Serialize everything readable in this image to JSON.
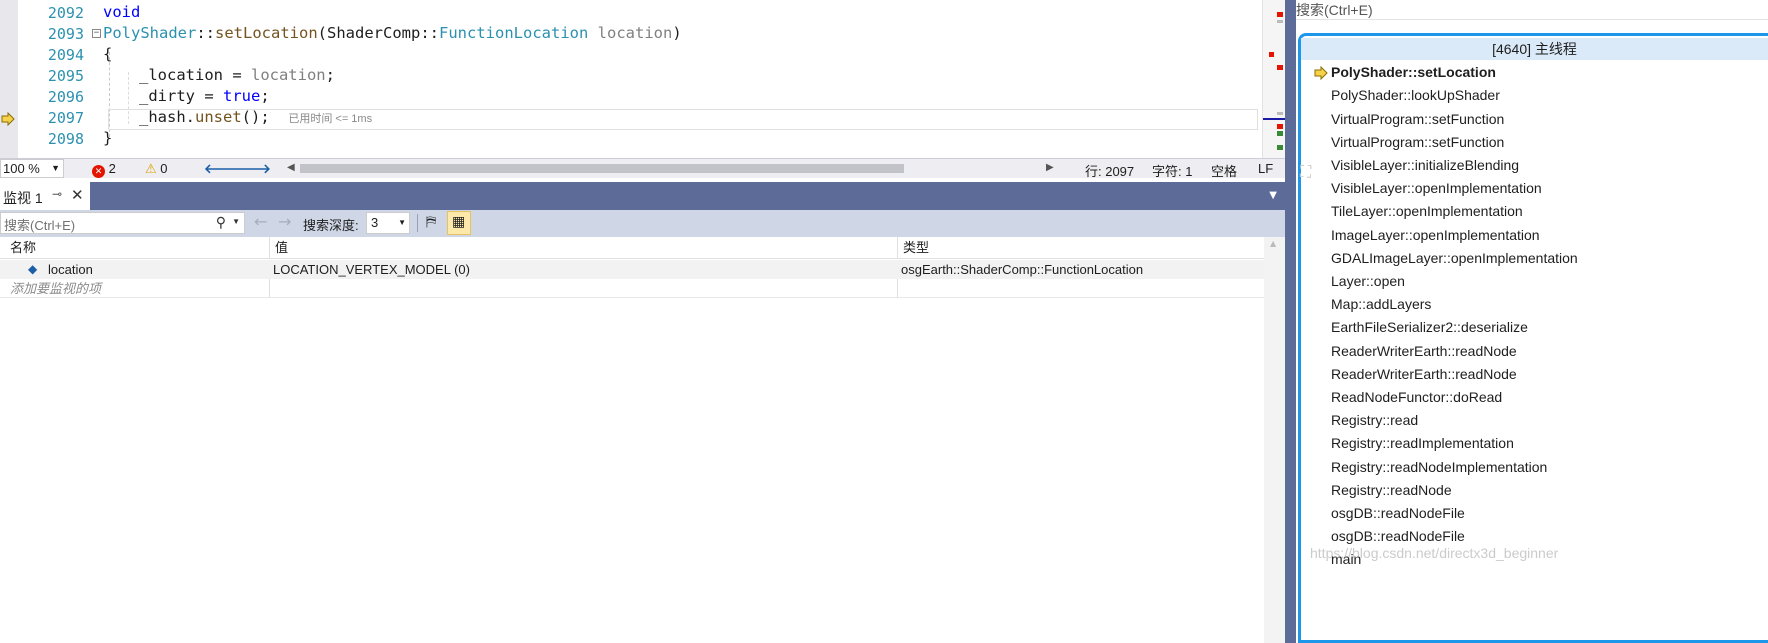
{
  "editor": {
    "line_numbers": [
      "2092",
      "2093",
      "2094",
      "2095",
      "2096",
      "2097",
      "2098"
    ],
    "line_2092": {
      "keyword": "void"
    },
    "line_2093": {
      "class": "PolyShader",
      "sep1": "::",
      "method": "setLocation",
      "open": "(",
      "ns": "ShaderComp",
      "sep2": "::",
      "type": "FunctionLocation",
      "param": "location",
      "close": ")"
    },
    "line_2094": {
      "text": "{"
    },
    "line_2095": {
      "lhs": "_location = ",
      "rhs": "location",
      "end": ";"
    },
    "line_2096": {
      "lhs": "_dirty = ",
      "kw": "true",
      "end": ";"
    },
    "line_2097": {
      "obj": "_hash.",
      "call": "unset",
      "end": "();",
      "hint": "已用时间 <= 1ms"
    },
    "line_2098": {
      "text": "}"
    }
  },
  "status_strip": {
    "zoom": "100 %",
    "errors": "2",
    "warnings": "0",
    "line": "行: 2097",
    "char": "字符: 1",
    "whitespace": "空格",
    "eol": "LF"
  },
  "watch": {
    "tab_label": "监视 1",
    "search_placeholder": "搜索(Ctrl+E)",
    "depth_label": "搜索深度:",
    "depth_value": "3",
    "columns": {
      "name": "名称",
      "value": "值",
      "type": "类型"
    },
    "rows": [
      {
        "name": "location",
        "value": "LOCATION_VERTEX_MODEL (0)",
        "type": "osgEarth::ShaderComp::FunctionLocation"
      }
    ],
    "add_item_text": "添加要监视的项"
  },
  "callstack": {
    "search_placeholder": "搜索(Ctrl+E)",
    "thread": "[4640] 主线程",
    "frames": [
      "PolyShader::setLocation",
      "PolyShader::lookUpShader",
      "VirtualProgram::setFunction",
      "VirtualProgram::setFunction",
      "VisibleLayer::initializeBlending",
      "VisibleLayer::openImplementation",
      "TileLayer::openImplementation",
      "ImageLayer::openImplementation",
      "GDALImageLayer::openImplementation",
      "Layer::open",
      "Map::addLayers",
      "EarthFileSerializer2::deserialize",
      "ReaderWriterEarth::readNode",
      "ReaderWriterEarth::readNode",
      "ReadNodeFunctor::doRead",
      "Registry::read",
      "Registry::readImplementation",
      "Registry::readNodeImplementation",
      "Registry::readNode",
      "osgDB::readNodeFile",
      "osgDB::readNodeFile",
      "main"
    ]
  },
  "watermark": "https://blog.csdn.net/directx3d_beginner",
  "colors": {
    "accent": "#1c97ea",
    "title_bar": "#5d6b99",
    "error": "#e51400",
    "warning": "#f3c20f"
  }
}
